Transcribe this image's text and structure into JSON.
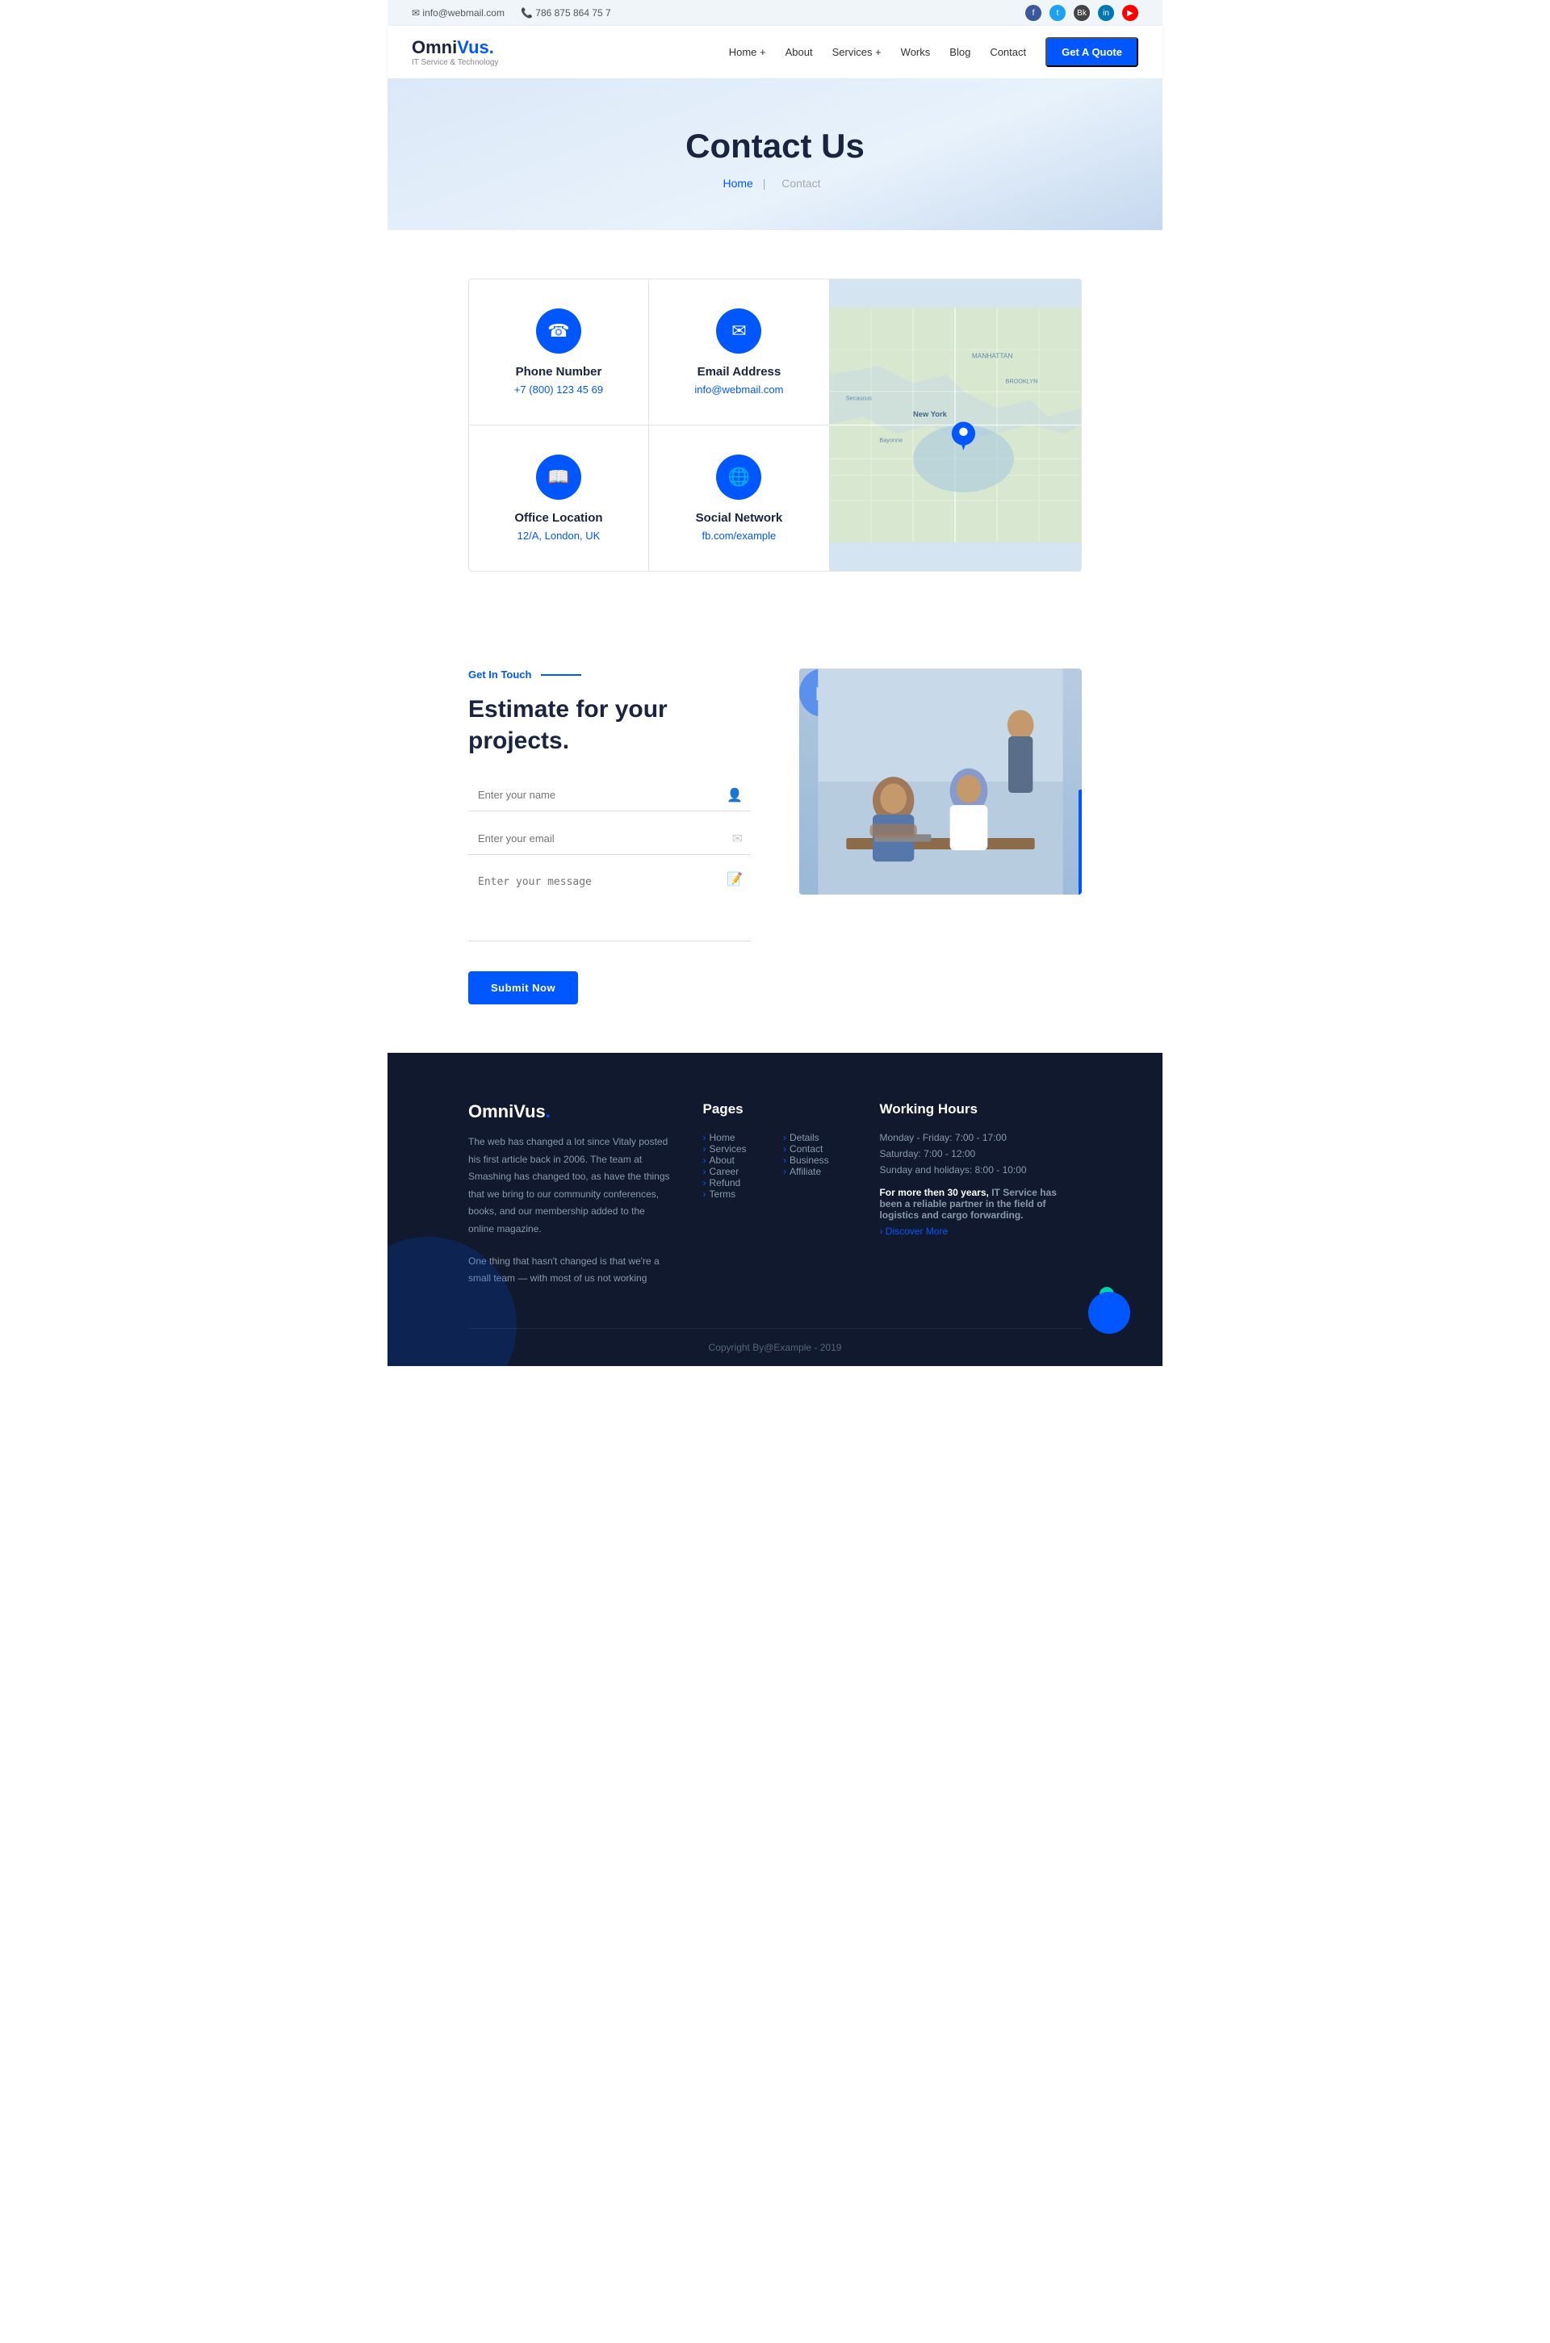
{
  "topbar": {
    "email_icon": "✉",
    "email": "info@webmail.com",
    "phone_icon": "📞",
    "phone": "786 875 864 75 7"
  },
  "logo": {
    "name_part1": "Omni",
    "name_part2": "Vus.",
    "tagline": "IT Service & Technology"
  },
  "nav": {
    "items": [
      {
        "label": "Home +",
        "id": "home"
      },
      {
        "label": "About",
        "id": "about"
      },
      {
        "label": "Services +",
        "id": "services"
      },
      {
        "label": "Works",
        "id": "works"
      },
      {
        "label": "Blog",
        "id": "blog"
      },
      {
        "label": "Contact",
        "id": "contact"
      }
    ],
    "cta": "Get A Quote"
  },
  "hero": {
    "title": "Contact Us",
    "breadcrumb_home": "Home",
    "breadcrumb_sep": "|",
    "breadcrumb_current": "Contact"
  },
  "contact_cards": [
    {
      "icon": "☎",
      "title": "Phone Number",
      "value": "+7 (800) 123 45 69"
    },
    {
      "icon": "✉",
      "title": "Email Address",
      "value": "info@webmail.com"
    },
    {
      "icon": "📖",
      "title": "Office Location",
      "value": "12/A, London, UK"
    },
    {
      "icon": "🌐",
      "title": "Social Network",
      "value": "fb.com/example"
    }
  ],
  "estimate": {
    "label": "Get In Touch",
    "title": "Estimate for your projects.",
    "form": {
      "name_placeholder": "Enter your name",
      "email_placeholder": "Enter your email",
      "message_placeholder": "Enter your message",
      "submit_label": "Submit Now"
    }
  },
  "footer": {
    "logo": "OmniVus.",
    "description1": "The web has changed a lot since Vitaly posted his first article back in 2006. The team at Smashing has changed too, as have the things that we bring to our community conferences, books, and our membership added to the online magazine.",
    "description2": "One thing that hasn't changed is that we're a small team — with most of us not working",
    "pages_title": "Pages",
    "pages_col1": [
      "Home",
      "Services",
      "About",
      "Career",
      "Refund",
      "Terms"
    ],
    "pages_col2": [
      "Details",
      "Contact",
      "Business",
      "Affiliate"
    ],
    "working_hours_title": "Working Hours",
    "working_hours": [
      "Monday - Friday: 7:00 - 17:00",
      "Saturday: 7:00 - 12:00",
      "Sunday and holidays: 8:00 - 10:00"
    ],
    "wh_bold": "For more then 30 years,",
    "wh_bold_text": " IT Service has been a reliable partner in the field of logistics and cargo forwarding.",
    "discover": "› Discover More",
    "copyright": "Copyright By@Example - 2019"
  },
  "social": {
    "icons": [
      {
        "name": "facebook",
        "label": "f"
      },
      {
        "name": "twitter",
        "label": "t"
      },
      {
        "name": "behance",
        "label": "bk"
      },
      {
        "name": "linkedin",
        "label": "in"
      },
      {
        "name": "youtube",
        "label": "▶"
      }
    ]
  }
}
